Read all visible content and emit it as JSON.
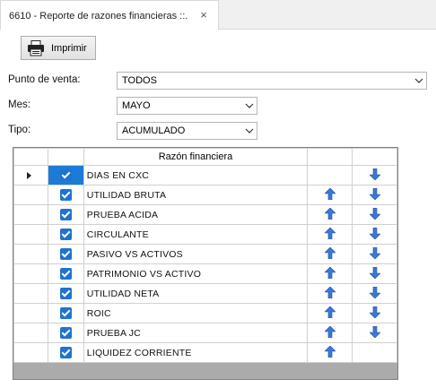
{
  "tab": {
    "title": "6610 - Reporte de razones financieras ::.",
    "close_glyph": "×"
  },
  "toolbar": {
    "print_label": "Imprimir"
  },
  "filters": {
    "punto_label": "Punto de venta:",
    "punto_value": "TODOS",
    "mes_label": "Mes:",
    "mes_value": "MAYO",
    "tipo_label": "Tipo:",
    "tipo_value": "ACUMULADO"
  },
  "grid": {
    "header": "Razón financiera",
    "rows": [
      {
        "name": "DIAS EN CXC",
        "checked": true,
        "up": false,
        "down": true,
        "selected": true
      },
      {
        "name": "UTILIDAD BRUTA",
        "checked": true,
        "up": true,
        "down": true,
        "selected": false
      },
      {
        "name": "PRUEBA ACIDA",
        "checked": true,
        "up": true,
        "down": true,
        "selected": false
      },
      {
        "name": "CIRCULANTE",
        "checked": true,
        "up": true,
        "down": true,
        "selected": false
      },
      {
        "name": "PASIVO VS ACTIVOS",
        "checked": true,
        "up": true,
        "down": true,
        "selected": false
      },
      {
        "name": "PATRIMONIO VS ACTIVO",
        "checked": true,
        "up": true,
        "down": true,
        "selected": false
      },
      {
        "name": "UTILIDAD NETA",
        "checked": true,
        "up": true,
        "down": true,
        "selected": false
      },
      {
        "name": "ROIC",
        "checked": true,
        "up": true,
        "down": true,
        "selected": false
      },
      {
        "name": "PRUEBA JC",
        "checked": true,
        "up": true,
        "down": true,
        "selected": false
      },
      {
        "name": "LIQUIDEZ CORRIENTE",
        "checked": true,
        "up": true,
        "down": false,
        "selected": false
      }
    ]
  },
  "colors": {
    "accent": "#1e73d0",
    "arrow": "#2f6fd6",
    "grid_bg": "#ababab"
  },
  "icons": {
    "print": "printer-icon",
    "up": "arrow-up-icon",
    "down": "arrow-down-icon",
    "dropdown": "chevron-down-icon"
  }
}
